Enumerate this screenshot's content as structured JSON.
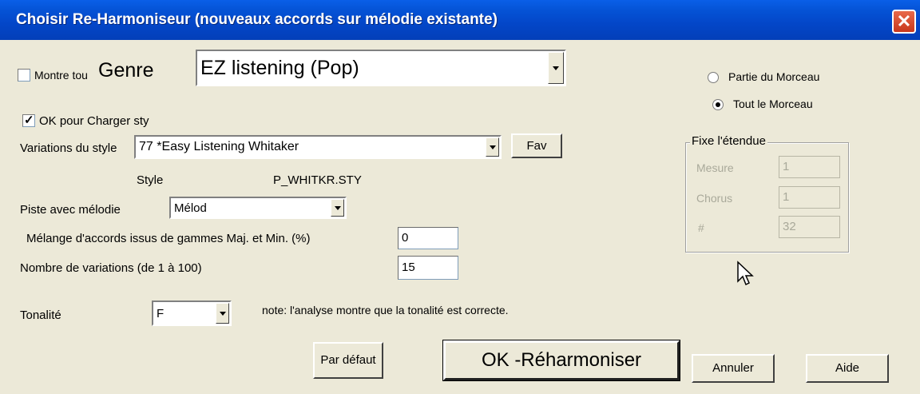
{
  "window": {
    "title": "Choisir Re-Harmoniseur (nouveaux accords sur mélodie existante)",
    "close_glyph": "✕"
  },
  "genre": {
    "show_all_label": "Montre tou",
    "show_all_checked": false,
    "genre_label": "Genre",
    "selected": "EZ listening (Pop)"
  },
  "load_style": {
    "label": "OK pour Charger sty",
    "checked": true
  },
  "style_variations": {
    "label": "Variations du style",
    "selected": "77 *Easy Listening Whitaker",
    "fav_button": "Fav"
  },
  "style_file": {
    "label": "Style",
    "value": "P_WHITKR.STY"
  },
  "melody_track": {
    "label": "Piste avec mélodie",
    "selected": "Mélod"
  },
  "mix_chords": {
    "label": "Mélange d'accords issus de gammes Maj. et Min. (%)",
    "value": "0"
  },
  "num_variations": {
    "label": "Nombre de variations (de 1 à 100)",
    "value": "15"
  },
  "key": {
    "label": "Tonalité",
    "selected": "F",
    "note": "note: l'analyse montre que la tonalité est correcte."
  },
  "scope": {
    "part_label": "Partie du Morceau",
    "whole_label": "Tout le Morceau",
    "selected": "whole"
  },
  "range": {
    "title": "Fixe l'étendue",
    "measure_label": "Mesure",
    "measure_value": "1",
    "chorus_label": "Chorus",
    "chorus_value": "1",
    "count_label": "#",
    "count_value": "32"
  },
  "buttons": {
    "default": "Par défaut",
    "ok": "OK -Réharmoniser",
    "cancel": "Annuler",
    "help": "Aide"
  }
}
